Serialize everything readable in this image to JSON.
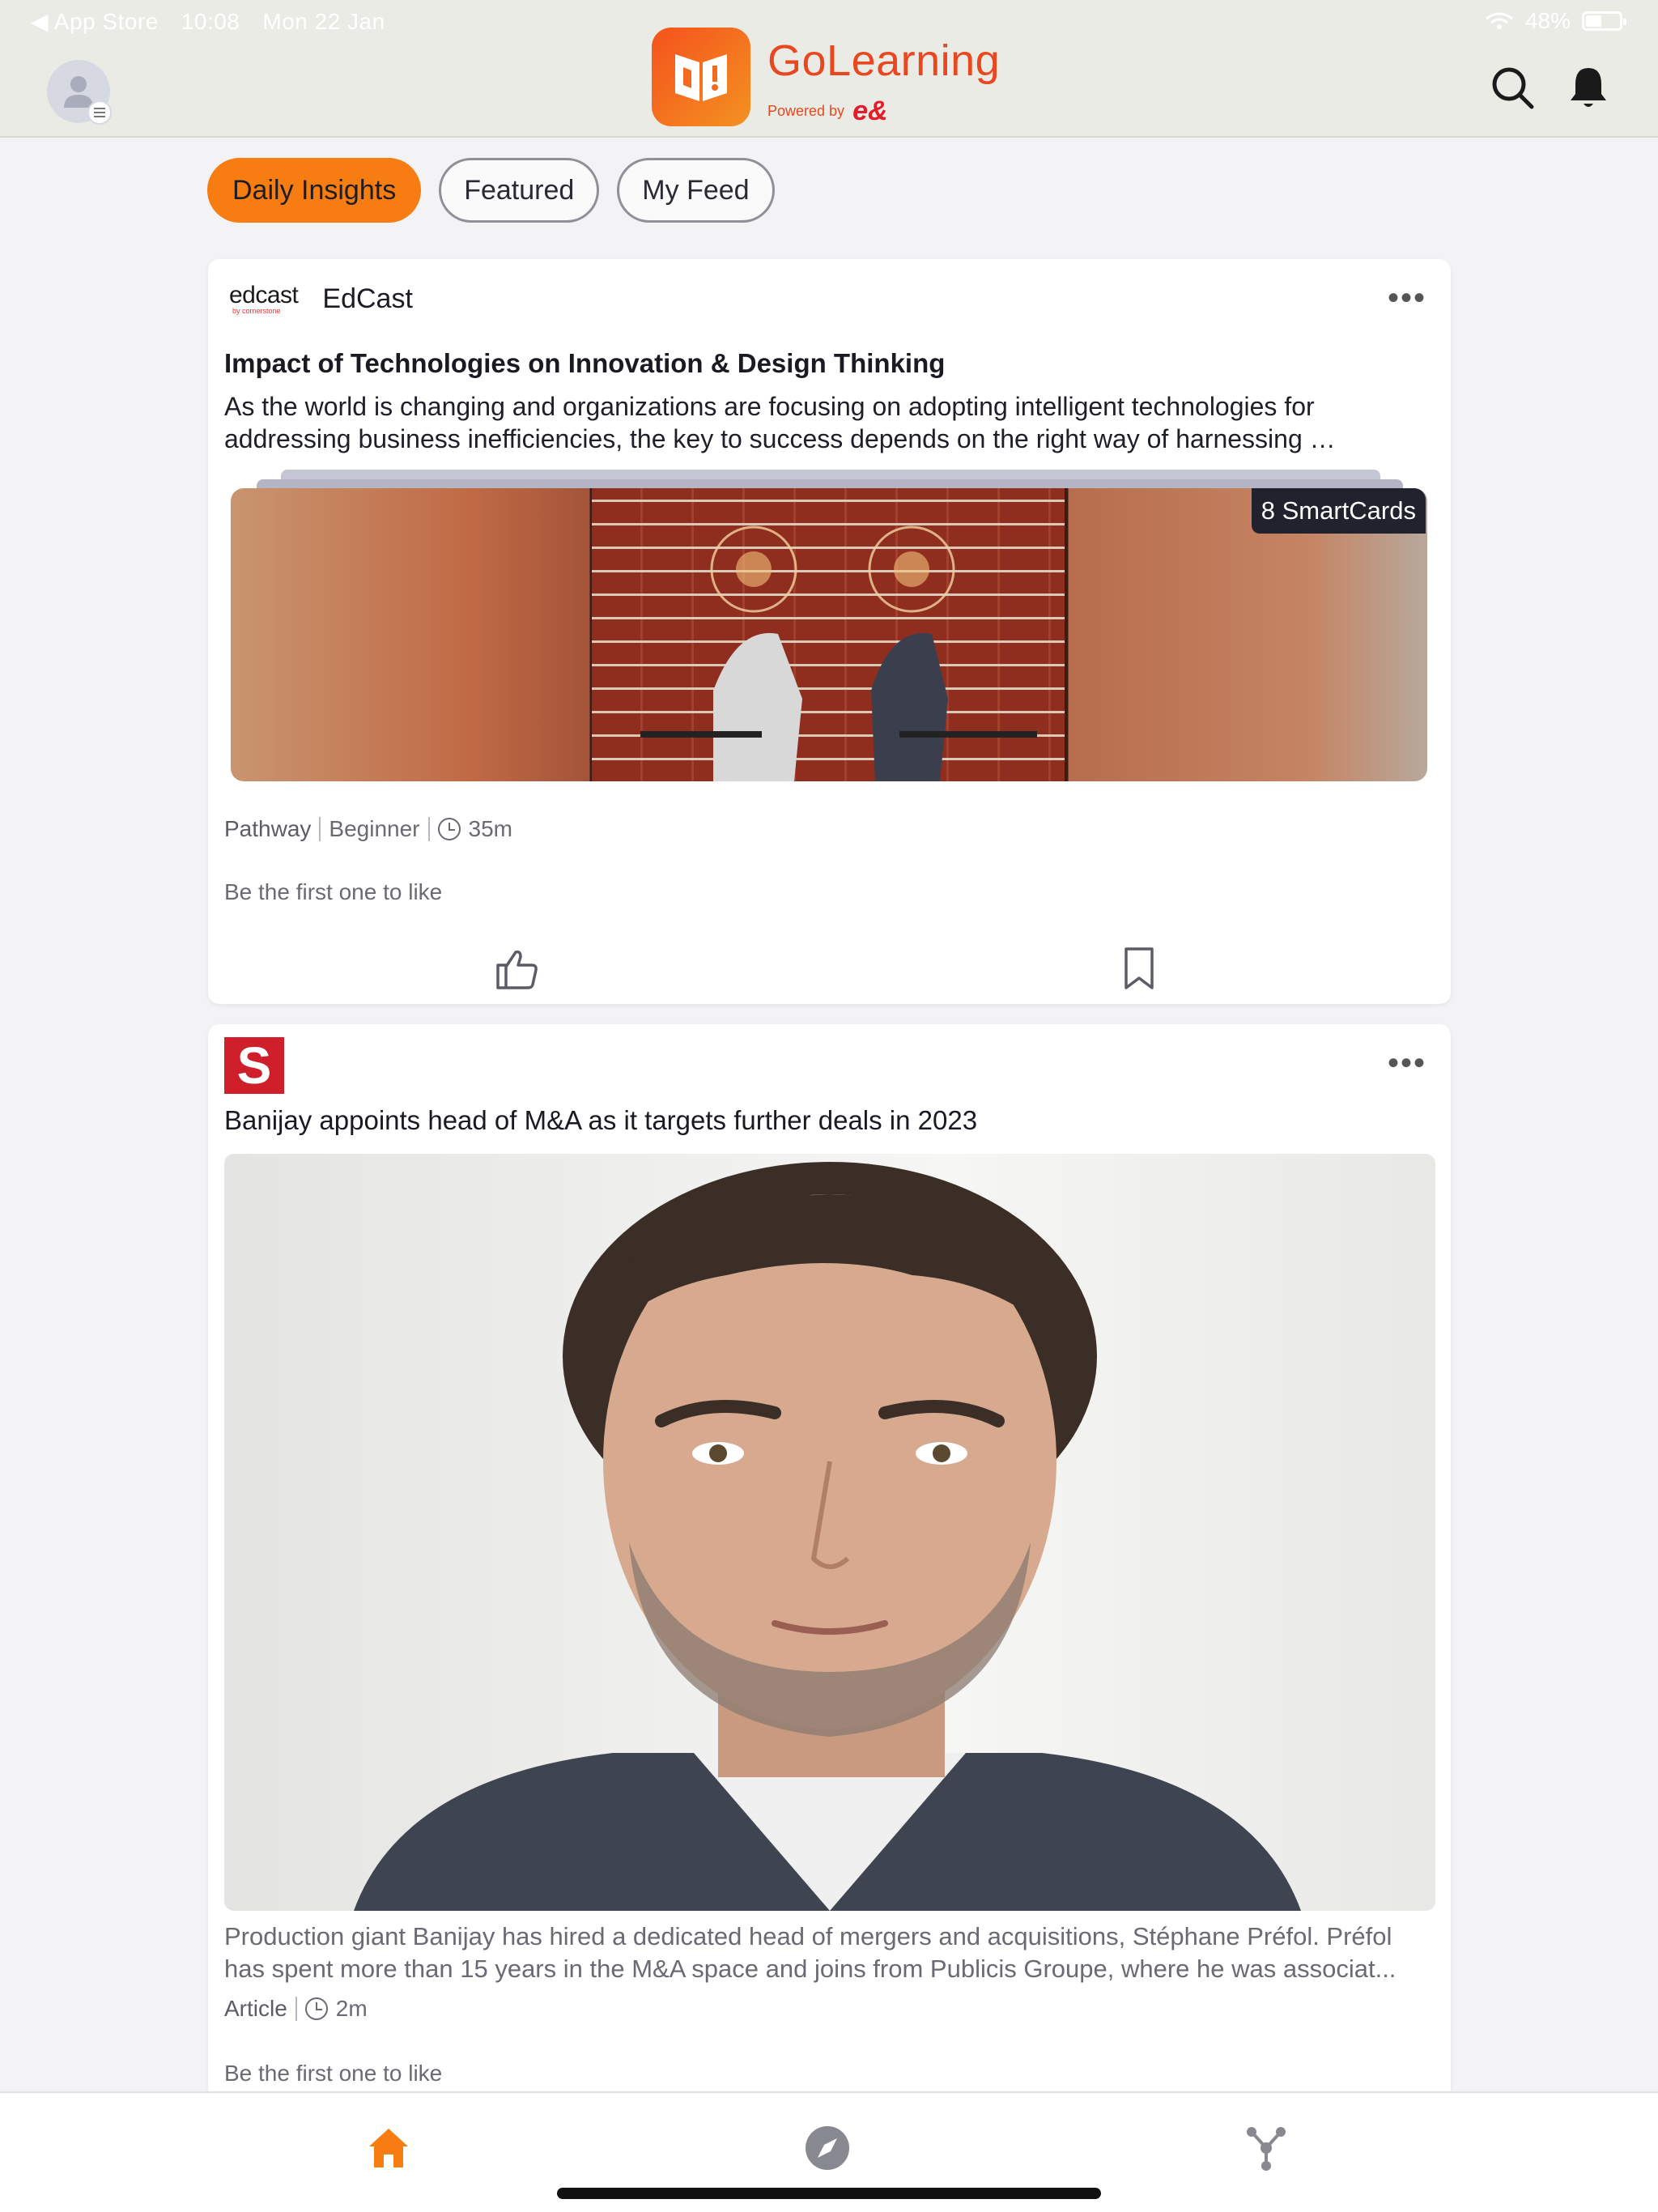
{
  "status_bar": {
    "back_app": "◀ App Store",
    "time": "10:08",
    "date": "Mon 22 Jan",
    "battery": "48%"
  },
  "header": {
    "brand": "GoLearning",
    "powered_by": "Powered by",
    "powered_by_brand": "e&",
    "icons": [
      "avatar-icon",
      "search-icon",
      "bell-icon"
    ]
  },
  "tabs": [
    {
      "label": "Daily Insights",
      "active": true
    },
    {
      "label": "Featured",
      "active": false
    },
    {
      "label": "My Feed",
      "active": false
    }
  ],
  "card1": {
    "source_logo_word": "edcast",
    "source_logo_sub": "by cornerstone",
    "source_name": "EdCast",
    "title": "Impact of Technologies on Innovation & Design Thinking",
    "description": "As the world is changing and organizations are focusing on adopting intelligent technologies for addressing business inefficiencies, the key to success depends on the right way of harnessing …",
    "badge": "8 SmartCards",
    "meta": {
      "type": "Pathway",
      "level": "Beginner",
      "duration": "35m"
    },
    "likes_text": "Be the first one to like"
  },
  "card2": {
    "source_logo_letter": "S",
    "title": "Banijay appoints head of M&A as it targets further deals in 2023",
    "description": "Production giant Banijay has hired a dedicated head of mergers and acquisitions, Stéphane Préfol. Préfol has spent more than 15 years in the M&A space and joins from Publicis Groupe, where he was associat...",
    "meta": {
      "type": "Article",
      "duration": "2m"
    },
    "likes_text": "Be the first one to like"
  },
  "bottom_nav": [
    "home-icon",
    "compass-icon",
    "network-icon"
  ],
  "colors": {
    "accent": "#f77d12",
    "brand": "#e8471f",
    "text": "#1a1a22",
    "muted": "#6a6a73"
  }
}
